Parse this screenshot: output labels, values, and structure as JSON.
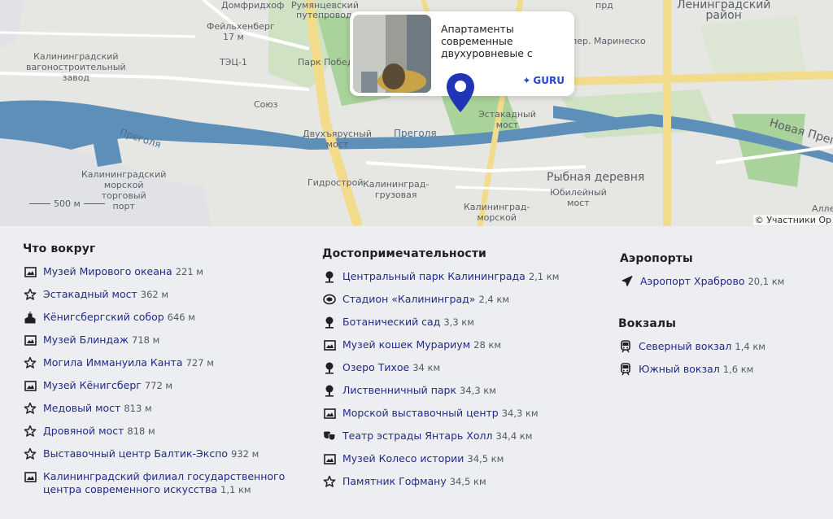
{
  "map": {
    "labels": {
      "domfridkhof": "Домфридхоф",
      "rumyantsev": "Румянцевский",
      "puteprovod": "путепровод",
      "feyl": "Фейльхенберг",
      "feyl2": "17 м",
      "vagon": "Калининградский\nвагоностроительный\nзавод",
      "tec": "ТЭЦ-1",
      "park": "Парк Победы",
      "soyuz": "Союз",
      "pregolya1": "Преголя",
      "pregolya2": "Преголя",
      "dvuh": "Двухъярусный\nмост",
      "estakada": "Эстакадный\nмост",
      "lenin": "Ленинградский\nрайон",
      "marinesk": "пер. Маринеско",
      "pruds": "прд",
      "nova": "Новая Преголя",
      "port": "Калининградский\nморской\nторговый\nпорт",
      "gidro": "Гидрострой",
      "gruz": "Калининград-\nгрузовая",
      "ryb": "Рыбная деревня",
      "yubil": "Юбилейный\nмост",
      "morsk": "Калининград-\nморской",
      "alleya": "Алле"
    },
    "scale": "500 м",
    "copyright": "© Участники Ор"
  },
  "popup": {
    "title": "Апартаменты современные двухуровневые с",
    "brand": "GURU"
  },
  "nearby": {
    "title": "Что вокруг",
    "items": [
      {
        "icon": "picture-icon",
        "name": "Музей Мирового океана",
        "dist": "221 м"
      },
      {
        "icon": "star-icon",
        "name": "Эстакадный мост",
        "dist": "362 м"
      },
      {
        "icon": "cathedral-icon",
        "name": "Кёнигсбергский собор",
        "dist": "646 м"
      },
      {
        "icon": "picture-icon",
        "name": "Музей Блиндаж",
        "dist": "718 м"
      },
      {
        "icon": "star-icon",
        "name": "Могила Иммануила Канта",
        "dist": "727 м"
      },
      {
        "icon": "picture-icon",
        "name": "Музей Кёнигсберг",
        "dist": "772 м"
      },
      {
        "icon": "star-icon",
        "name": "Медовый мост",
        "dist": "813 м"
      },
      {
        "icon": "star-icon",
        "name": "Дровяной мост",
        "dist": "818 м"
      },
      {
        "icon": "star-icon",
        "name": "Выставочный центр Балтик-Экспо",
        "dist": "932 м"
      },
      {
        "icon": "picture-icon",
        "name": "Калининградский филиал государственного центра современного искусства",
        "dist": "1,1 км"
      }
    ]
  },
  "sights": {
    "title": "Достопримечательности",
    "items": [
      {
        "icon": "tree-icon",
        "name": "Центральный парк Калининграда",
        "dist": "2,1 км"
      },
      {
        "icon": "stadium-icon",
        "name": "Стадион «Калининград»",
        "dist": "2,4 км"
      },
      {
        "icon": "tree-icon",
        "name": "Ботанический сад",
        "dist": "3,3 км"
      },
      {
        "icon": "picture-icon",
        "name": "Музей кошек Мурариум",
        "dist": "28 км"
      },
      {
        "icon": "tree-icon",
        "name": "Озеро Тихое",
        "dist": "34 км"
      },
      {
        "icon": "tree-icon",
        "name": "Лиственничный парк",
        "dist": "34,3 км"
      },
      {
        "icon": "picture-icon",
        "name": "Морской выставочный центр",
        "dist": "34,3 км"
      },
      {
        "icon": "theatre-icon",
        "name": "Театр эстрады Янтарь Холл",
        "dist": "34,4 км"
      },
      {
        "icon": "picture-icon",
        "name": "Музей Колесо истории",
        "dist": "34,5 км"
      },
      {
        "icon": "star-icon",
        "name": "Памятник Гофману",
        "dist": "34,5 км"
      }
    ]
  },
  "airports": {
    "title": "Аэропорты",
    "items": [
      {
        "icon": "plane-icon",
        "name": "Аэропорт Храброво",
        "dist": "20,1 км"
      }
    ]
  },
  "stations": {
    "title": "Вокзалы",
    "items": [
      {
        "icon": "train-icon",
        "name": "Северный вокзал",
        "dist": "1,4 км"
      },
      {
        "icon": "train-icon",
        "name": "Южный вокзал",
        "dist": "1,6 км"
      }
    ]
  },
  "colors": {
    "link": "#222a8a",
    "pin": "#1f35b5",
    "water": "#5d8fb8",
    "park": "#a7d29a",
    "road": "#f2dc8c"
  }
}
